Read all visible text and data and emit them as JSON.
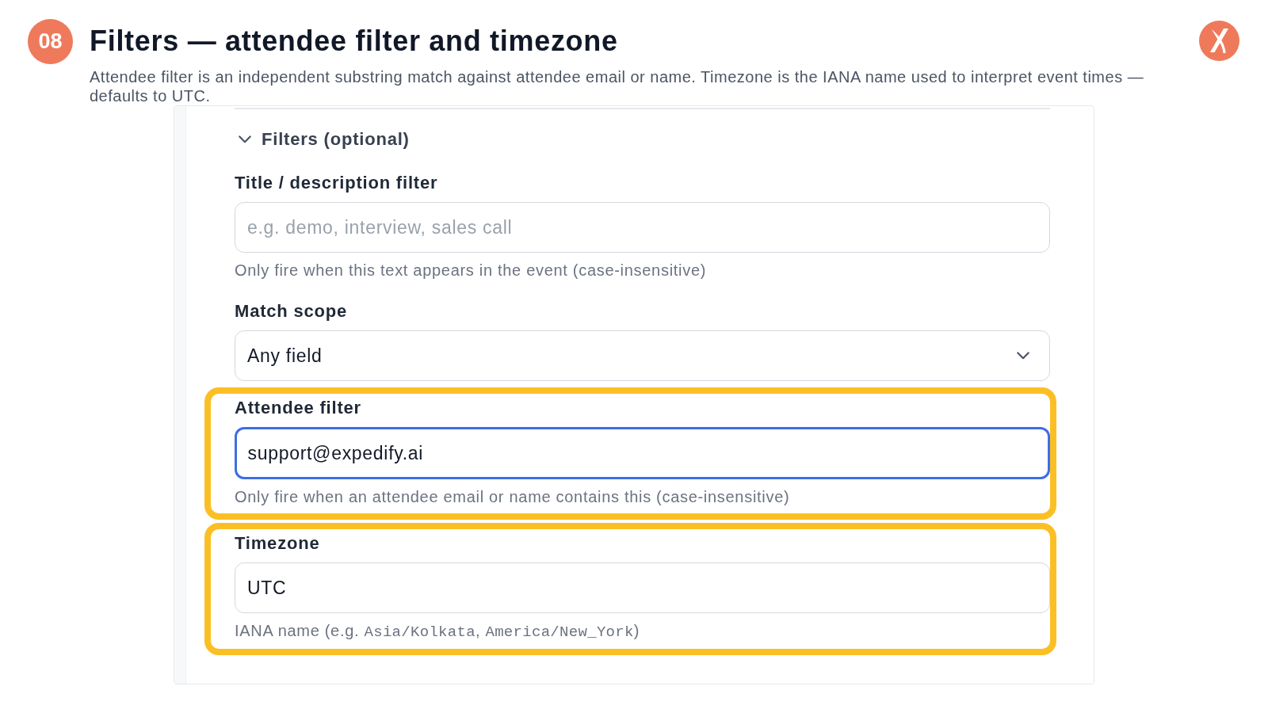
{
  "slide": {
    "number": "08",
    "title": "Filters — attendee filter and timezone",
    "subtitle": "Attendee filter is an independent substring match against attendee email or name. Timezone is the IANA name used to interpret event times — defaults to UTC."
  },
  "form": {
    "section": {
      "label": "Filters (optional)",
      "expanded": true
    },
    "fields": [
      {
        "kind": "text",
        "label": "Title / description filter",
        "placeholder": "e.g. demo, interview, sales call",
        "hint": [
          {
            "kind": "text",
            "text": "Only fire when this text appears in the event (case-insensitive)"
          }
        ],
        "focused": false,
        "highlighted": false
      },
      {
        "kind": "select",
        "label": "Match scope",
        "value": "Any field",
        "focused": false,
        "highlighted": false
      },
      {
        "kind": "text",
        "label": "Attendee filter",
        "value": "support@expedify.ai",
        "hint": [
          {
            "kind": "text",
            "text": "Only fire when an attendee email or name contains this (case-insensitive)"
          }
        ],
        "focused": true,
        "highlighted": true
      },
      {
        "kind": "text",
        "label": "Timezone",
        "value": "UTC",
        "hint": [
          {
            "kind": "text",
            "text": "IANA name (e.g. "
          },
          {
            "kind": "code",
            "text": "Asia/Kolkata"
          },
          {
            "kind": "text",
            "text": ", "
          },
          {
            "kind": "code",
            "text": "America/New_York"
          },
          {
            "kind": "text",
            "text": ")"
          }
        ],
        "focused": false,
        "highlighted": true
      }
    ]
  }
}
